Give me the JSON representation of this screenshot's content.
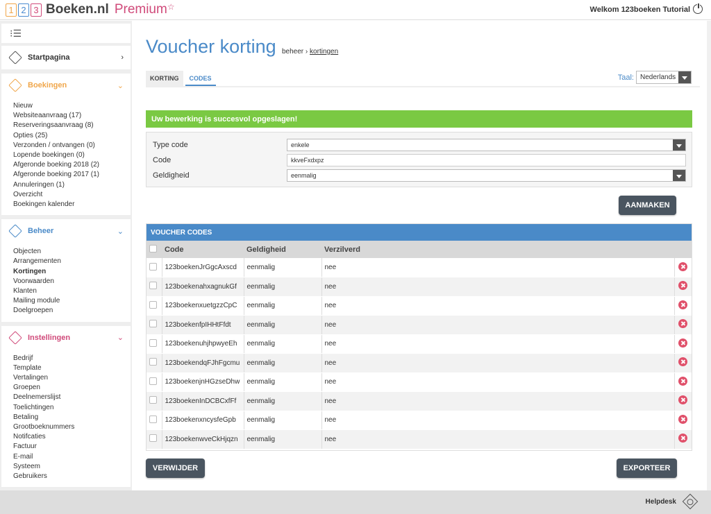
{
  "logo": {
    "digits": [
      "1",
      "2",
      "3"
    ],
    "name": "Boeken.nl",
    "premium": "Premium",
    "star": "☆"
  },
  "header": {
    "welcome": "Welkom 123boeken Tutorial",
    "power_icon": "power-icon"
  },
  "sidebar": {
    "startpagina": "Startpagina",
    "boekingen": {
      "title": "Boekingen",
      "color": "#f0a64a",
      "items": [
        "Nieuw",
        "Websiteaanvraag (17)",
        "Reserveringsaanvraag (8)",
        "Opties (25)",
        "Verzonden / ontvangen (0)",
        "Lopende boekingen (0)",
        "Afgeronde boeking 2018 (2)",
        "Afgeronde boeking 2017 (1)",
        "Annuleringen (1)",
        "Overzicht",
        "Boekingen kalender"
      ]
    },
    "beheer": {
      "title": "Beheer",
      "color": "#4a8ac8",
      "items": [
        "Objecten",
        "Arrangementen",
        "Kortingen",
        "Voorwaarden",
        "Klanten",
        "Mailing module",
        "Doelgroepen"
      ],
      "active": "Kortingen"
    },
    "instellingen": {
      "title": "Instellingen",
      "color": "#d04a7a",
      "items": [
        "Bedrijf",
        "Template",
        "Vertalingen",
        "Groepen",
        "Deelnemerslijst",
        "Toelichtingen",
        "Betaling",
        "Grootboeknummers",
        "Notifcaties",
        "Factuur",
        "E-mail",
        "Systeem",
        "Gebruikers"
      ]
    }
  },
  "main": {
    "title": "Voucher korting",
    "breadcrumb": {
      "part1": "beheer",
      "sep": "›",
      "part2": "kortingen"
    },
    "tabs": [
      "KORTING",
      "CODES"
    ],
    "lang_label": "Taal:",
    "lang_value": "Nederlands",
    "success": "Uw bewerking is succesvol opgeslagen!",
    "form": {
      "type_label": "Type code",
      "type_value": "enkele",
      "code_label": "Code",
      "code_value": "kkveFxdxpz",
      "geldigheid_label": "Geldigheid",
      "geldigheid_value": "eenmalig"
    },
    "aanmaken": "AANMAKEN",
    "codes_title": "VOUCHER CODES",
    "columns": [
      "Code",
      "Geldigheid",
      "Verzilverd"
    ],
    "rows": [
      {
        "code": "123boekenJrGgcAxscd",
        "geldigheid": "eenmalig",
        "verzilverd": "nee"
      },
      {
        "code": "123boekenahxagnukGf",
        "geldigheid": "eenmalig",
        "verzilverd": "nee"
      },
      {
        "code": "123boekenxuetgzzCpC",
        "geldigheid": "eenmalig",
        "verzilverd": "nee"
      },
      {
        "code": "123boekenfpIHHtFfdt",
        "geldigheid": "eenmalig",
        "verzilverd": "nee"
      },
      {
        "code": "123boekenuhjhpwyeEh",
        "geldigheid": "eenmalig",
        "verzilverd": "nee"
      },
      {
        "code": "123boekendqFJhFgcmu",
        "geldigheid": "eenmalig",
        "verzilverd": "nee"
      },
      {
        "code": "123boekenjnHGzseDhw",
        "geldigheid": "eenmalig",
        "verzilverd": "nee"
      },
      {
        "code": "123boekenInDCBCxfFf",
        "geldigheid": "eenmalig",
        "verzilverd": "nee"
      },
      {
        "code": "123boekenxncysfeGpb",
        "geldigheid": "eenmalig",
        "verzilverd": "nee"
      },
      {
        "code": "123boekenwveCkHjqzn",
        "geldigheid": "eenmalig",
        "verzilverd": "nee"
      }
    ],
    "verwijder": "VERWIJDER",
    "exporteer": "EXPORTEER"
  },
  "footer": {
    "helpdesk": "Helpdesk"
  }
}
